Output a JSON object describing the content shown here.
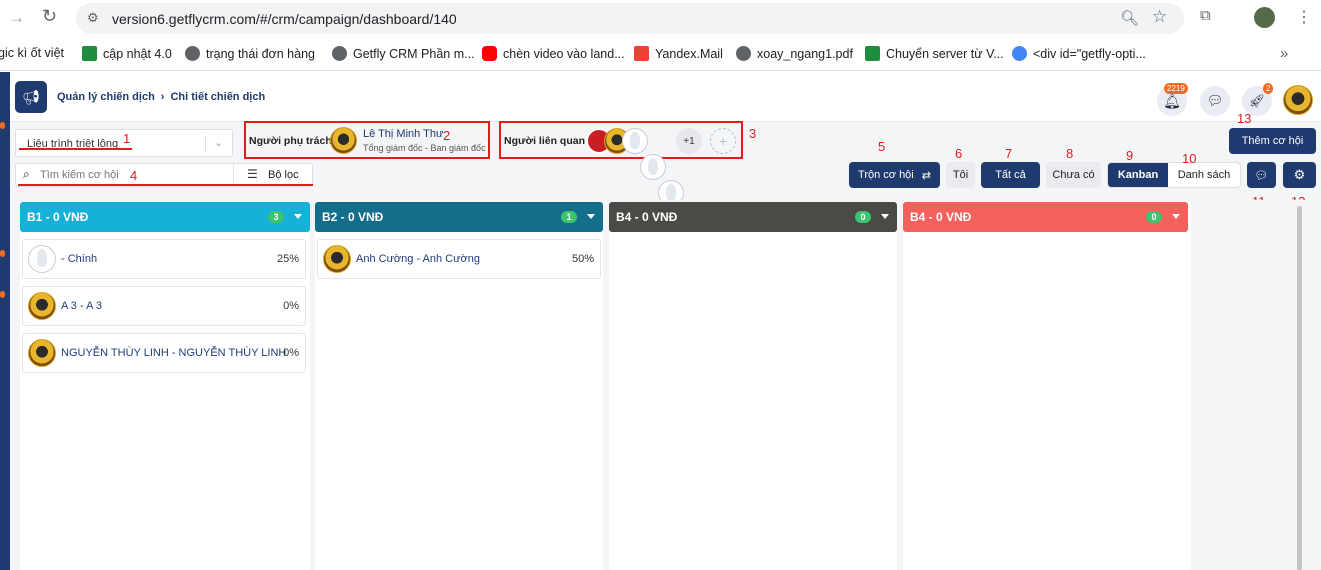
{
  "browser": {
    "url": "version6.getflycrm.com/#/crm/campaign/dashboard/140",
    "bookmarks": [
      {
        "label": "gic kì ốt việt",
        "icon": "orange-dot-icon",
        "color": "#f36b21"
      },
      {
        "label": "cập nhật 4.0",
        "icon": "sheets-icon",
        "color": "#1e8e3e"
      },
      {
        "label": "trạng thái đơn hàng",
        "icon": "globe-icon",
        "color": "#5f6368"
      },
      {
        "label": "Getfly CRM Phần m...",
        "icon": "globe-icon",
        "color": "#5f6368"
      },
      {
        "label": "chèn video vào land...",
        "icon": "youtube-icon",
        "color": "#ff0000"
      },
      {
        "label": "Yandex.Mail",
        "icon": "mail-icon",
        "color": "#ea4335"
      },
      {
        "label": "xoay_ngang1.pdf",
        "icon": "globe-icon",
        "color": "#5f6368"
      },
      {
        "label": "Chuyển server từ V...",
        "icon": "sheets-icon",
        "color": "#1e8e3e"
      },
      {
        "label": "<div id=\"getfly-opti...",
        "icon": "google-icon",
        "color": "#4285f4"
      }
    ]
  },
  "breadcrumb": {
    "parent": "Quản lý chiến dịch",
    "separator": "›",
    "current": "Chi tiết chiến dịch"
  },
  "topbar": {
    "notification_count": "2219",
    "rocket_count": "2"
  },
  "filters": {
    "process_select": "Liệu trình triệt lông",
    "owner_label": "Người phụ trách",
    "owner_name": "Lê Thị Minh Thư",
    "owner_title": "Tổng giám đốc - Ban giám đốc",
    "related_label": "Người liên quan",
    "related_more": "+1",
    "search_placeholder": "Tìm kiếm cơ hội",
    "filter_label": "Bộ lọc"
  },
  "actions": {
    "add_opportunity": "Thêm cơ hội",
    "merge": "Trộn cơ hội",
    "me": "Tôi",
    "all": "Tất cả",
    "none": "Chưa có",
    "kanban": "Kanban",
    "list": "Danh sách"
  },
  "annotations": [
    "1",
    "2",
    "3",
    "4",
    "5",
    "6",
    "7",
    "8",
    "9",
    "10",
    "11",
    "12",
    "13"
  ],
  "columns": [
    {
      "title": "B1 - 0 VNĐ",
      "count": "3",
      "color": "#17b0d8",
      "cards": [
        {
          "name": "- Chính",
          "percent": "25%",
          "avatar": "ghost"
        },
        {
          "name": "A 3 - A 3",
          "percent": "0%",
          "avatar": "photo"
        },
        {
          "name": "NGUYỄN THÙY LINH - NGUYỄN THÙY LINH",
          "percent": "0%",
          "avatar": "photo"
        }
      ]
    },
    {
      "title": "B2 - 0 VNĐ",
      "count": "1",
      "color": "#126e8a",
      "cards": [
        {
          "name": "Anh Cường - Anh Cường",
          "percent": "50%",
          "avatar": "photo"
        }
      ]
    },
    {
      "title": "B4 - 0 VNĐ",
      "count": "0",
      "color": "#4b4a47",
      "cards": []
    },
    {
      "title": "B4 - 0 VNĐ",
      "count": "0",
      "color": "#f2615b",
      "cards": []
    }
  ]
}
